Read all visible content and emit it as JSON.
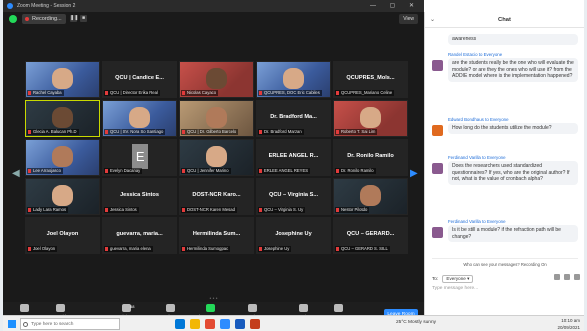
{
  "window": {
    "title": "Zoom Meeting - Session 2",
    "controls": "— ▢ ✕"
  },
  "topbar": {
    "recording": "Recording...",
    "view": "View"
  },
  "tiles": [
    {
      "name": "",
      "label": "Rachel Cayaba",
      "video": "blue",
      "active": false
    },
    {
      "name": "QCU | Candice E...",
      "label": "QCU | Director Erika Real",
      "video": "",
      "active": false
    },
    {
      "name": "",
      "label": "Nicolas Cayaco",
      "video": "red",
      "active": false
    },
    {
      "name": "",
      "label": "QCUPRES, DOC Eric Cabiles",
      "video": "blue",
      "active": false
    },
    {
      "name": "QCUPRES_Mols...",
      "label": "QCUPRES_Mariano Celine",
      "video": "",
      "active": false
    },
    {
      "name": "",
      "label": "Glecia A. Balucan Ph.D",
      "video": "dark",
      "active": true
    },
    {
      "name": "",
      "label": "QCU | SV. Nora So Santiago",
      "video": "blue",
      "active": false
    },
    {
      "name": "",
      "label": "QCU | Dr. Gilberto Barcelo",
      "video": "room",
      "active": false
    },
    {
      "name": "Dr. Bradford Ma...",
      "label": "Dr. Bradford Marzan",
      "video": "",
      "active": false
    },
    {
      "name": "",
      "label": "Roberto T. Sai Lim",
      "video": "red",
      "active": false
    },
    {
      "name": "",
      "label": "Lee Arraojasco",
      "video": "blue",
      "active": false
    },
    {
      "name": "E",
      "label": "Evelyn Dacanay",
      "video": "avatar",
      "active": false
    },
    {
      "name": "",
      "label": "QCU | Jennifer Marino",
      "video": "dark",
      "active": false
    },
    {
      "name": "ERLEE ANGEL R...",
      "label": "ERLEE ANGEL REYES",
      "video": "",
      "active": false
    },
    {
      "name": "Dr. Ronilo Ramilo",
      "label": "Dr. Ronilo Ramilo",
      "video": "",
      "active": false
    },
    {
      "name": "",
      "label": "Lady Lara Ramos",
      "video": "dark",
      "active": false
    },
    {
      "name": "Jessica Sintos",
      "label": "Jessica Sintos",
      "video": "",
      "active": false
    },
    {
      "name": "DOST-NCR Karo...",
      "label": "DOST-NCR Karen Mesad",
      "video": "",
      "active": false
    },
    {
      "name": "QCU – Virginia S...",
      "label": "QCU – Virginia S. Uy",
      "video": "",
      "active": false
    },
    {
      "name": "",
      "label": "Nestor Pilotdo",
      "video": "dark",
      "active": false
    },
    {
      "name": "Joel Olayon",
      "label": "Joel Olayon",
      "video": "",
      "active": false
    },
    {
      "name": "guevarra, maria...",
      "label": "guevarra, maria elena",
      "video": "",
      "active": false
    },
    {
      "name": "Hermilinda Sum...",
      "label": "Hermilinda Sumogpac",
      "video": "",
      "active": false
    },
    {
      "name": "Josephine Uy",
      "label": "Josephine Uy",
      "video": "",
      "active": false
    },
    {
      "name": "QCU – GERARD...",
      "label": "QCU – GERARD S. SILL",
      "video": "",
      "active": false
    }
  ],
  "toolbar": {
    "unmute": "Unmute",
    "video": "Start Video",
    "participants": "Participants",
    "participants_count": "58",
    "chat": "Chat",
    "share": "Share Screen",
    "pause": "Pause/Stop Recording",
    "reactions": "Reactions",
    "more": "More",
    "leave": "Leave Room"
  },
  "chat": {
    "title": "Chat",
    "messages": [
      {
        "from": "",
        "text": "awareness",
        "avatar": "purple"
      },
      {
        "from": "Randel Estacio to Everyone",
        "text": "are the students really be the one who will evaluate the module? or are they the ones who will use it? from the ADDIE model where is the implementation happened?",
        "avatar": "purple"
      },
      {
        "from": "Edward Bondhaus to Everyone",
        "text": "How long do the students utilize the module?",
        "avatar": "orange"
      },
      {
        "from": "Ferdinand Varilla to Everyone",
        "text": "Does the researchers used standardized questionnaires? If yes, who are the original author? If not, what is the value of cronbach alpha?",
        "avatar": "purple"
      },
      {
        "from": "Ferdinand Varilla to Everyone",
        "text": "Is it be still a module? if the refraction path will be change?",
        "avatar": "purple"
      }
    ],
    "info": "Who can see your messages? Recording On",
    "to_label": "To:",
    "to_value": "Everyone ▾",
    "placeholder": "Type message here..."
  },
  "taskbar": {
    "search": "Type here to search",
    "weather": "25°C  Mostly sunny",
    "time": "10:10 am",
    "date": "20/09/2021"
  },
  "colors": {
    "accent": "#2d8cff",
    "share": "#23d959",
    "active_speaker": "#c9d900",
    "record": "#e23b3b"
  }
}
